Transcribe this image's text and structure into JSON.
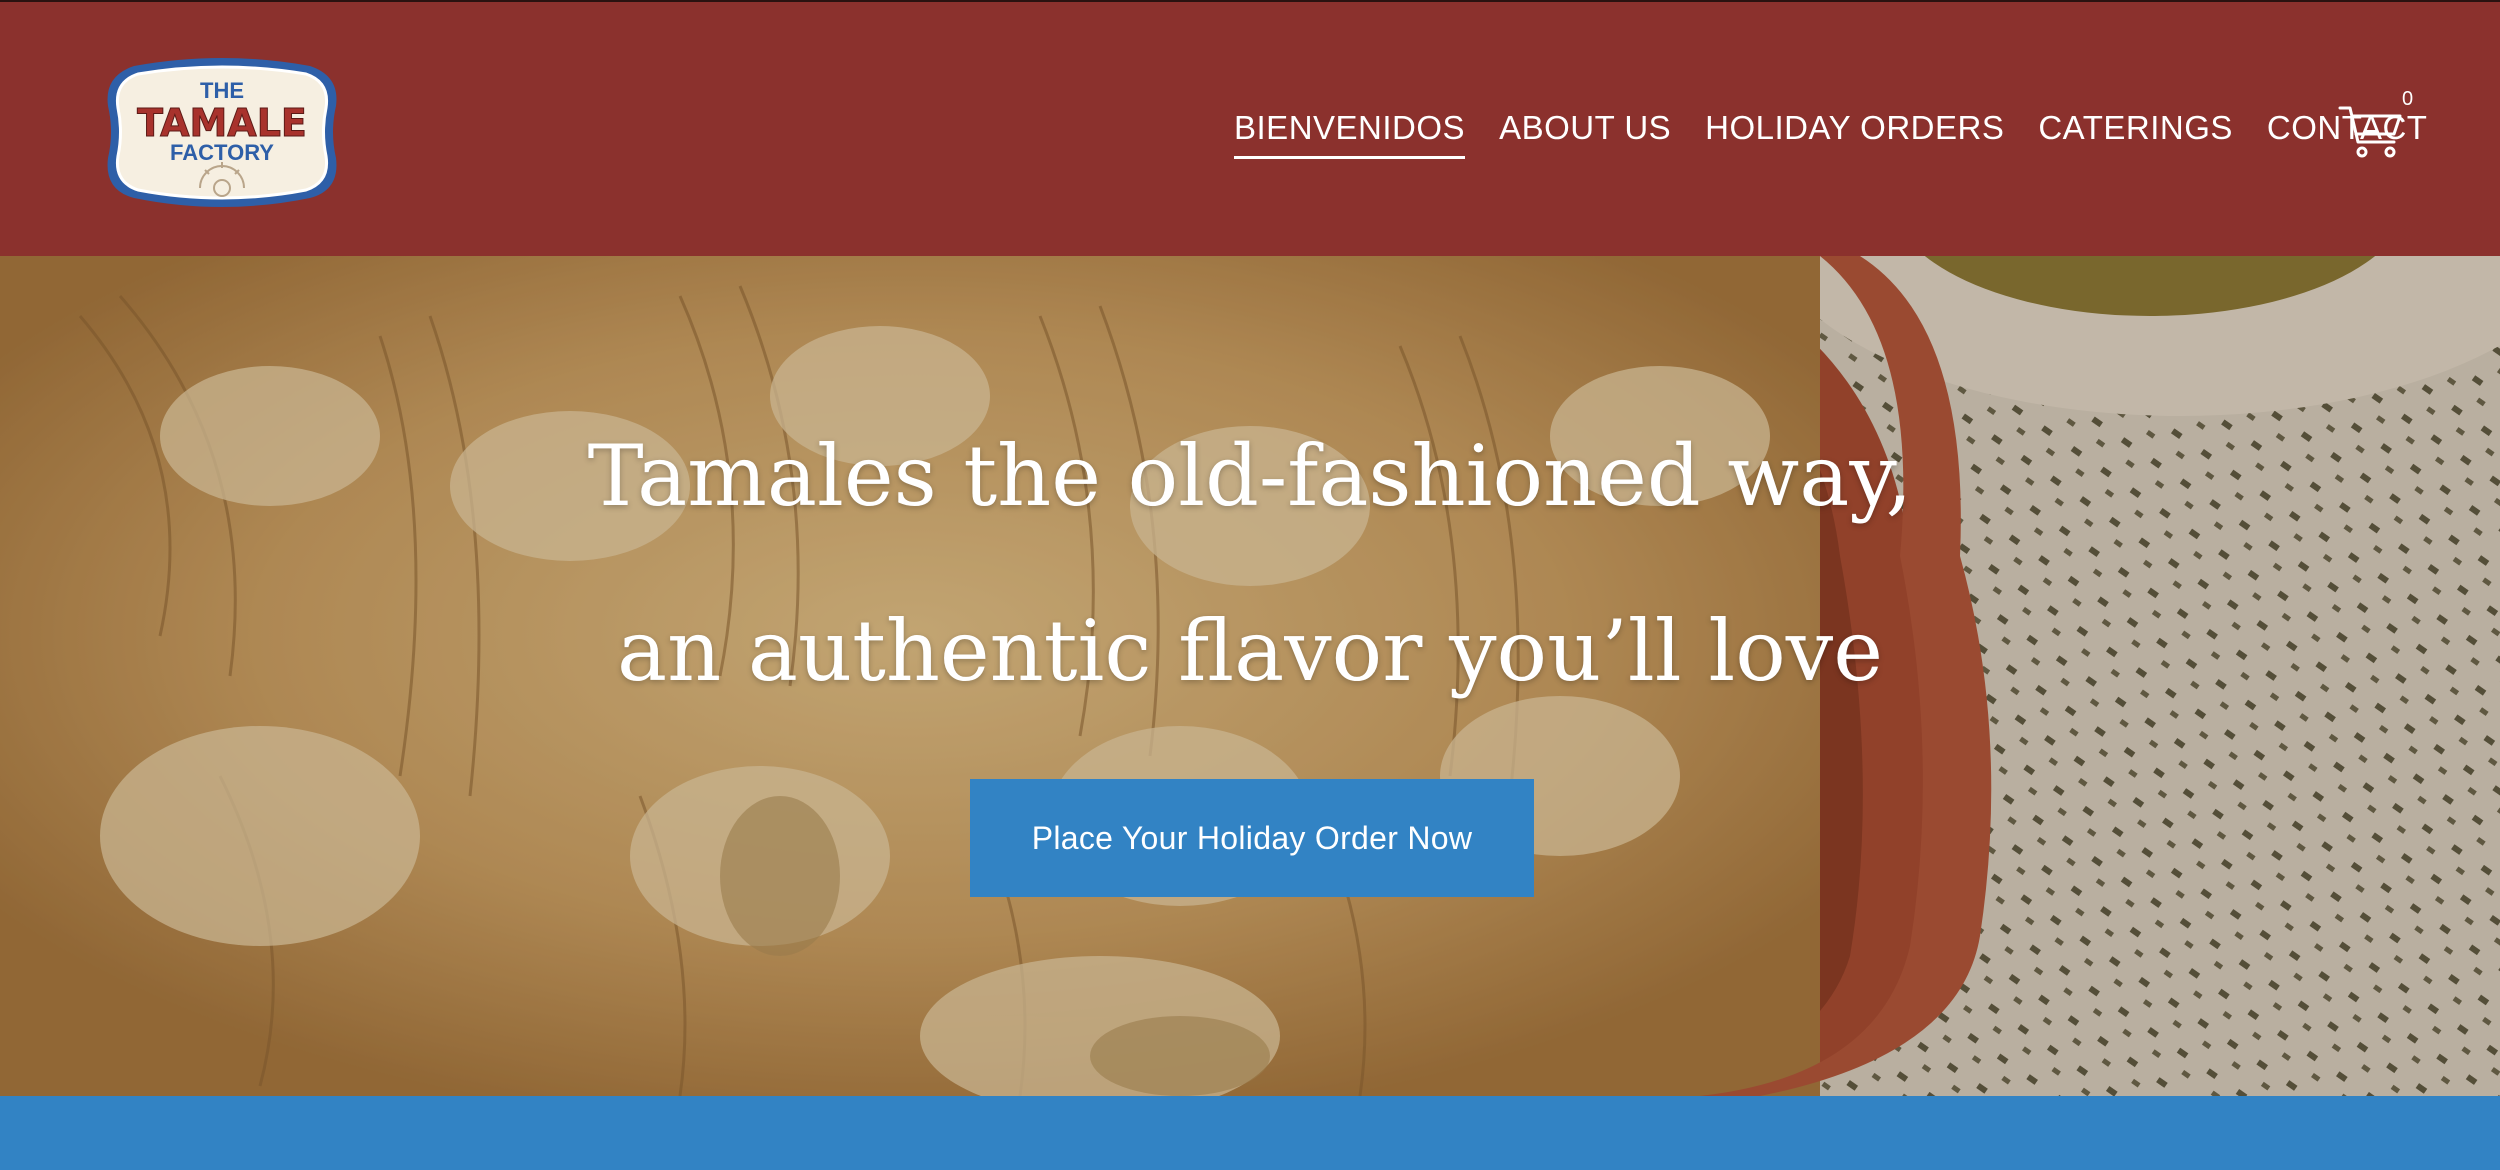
{
  "brand": {
    "logo_line1": "THE",
    "logo_line2": "TAMALE",
    "logo_line3": "FACTORY"
  },
  "nav": {
    "items": [
      {
        "label": "BIENVENIDOS",
        "active": true
      },
      {
        "label": "ABOUT US",
        "active": false
      },
      {
        "label": "HOLIDAY ORDERS",
        "active": false
      },
      {
        "label": "CATERINGS",
        "active": false
      },
      {
        "label": "CONTACT",
        "active": false
      }
    ]
  },
  "cart": {
    "icon": "shopping-cart-icon",
    "count": "0"
  },
  "hero": {
    "title_line1": "Tamales the old-fashioned way,",
    "title_line2": "an authentic flavor you’ll love",
    "cta_label": "Place Your Holiday Order Now",
    "image": "tamales-in-clay-bowl"
  },
  "colors": {
    "header_bg": "#8b312d",
    "accent_blue": "#3283c4",
    "text_on_dark": "#ffffff"
  }
}
